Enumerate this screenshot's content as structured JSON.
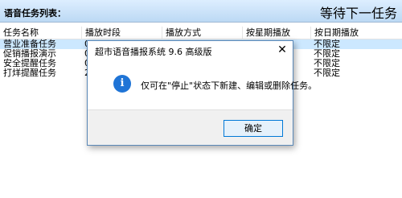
{
  "header": {
    "title": "语音任务列表：",
    "status": "等待下一任务"
  },
  "table": {
    "columns": [
      "任务名称",
      "播放时段",
      "播放方式",
      "按星期播放",
      "按日期播放"
    ],
    "rows": [
      [
        "营业准备任务",
        "0",
        "",
        "",
        "不限定"
      ],
      [
        "促销播报演示",
        "0",
        "",
        "",
        "不限定"
      ],
      [
        "安全提醒任务",
        "0",
        "",
        "",
        "不限定"
      ],
      [
        "打烊提醒任务",
        "2",
        "",
        "",
        "不限定"
      ]
    ]
  },
  "dialog": {
    "title": "超市语音播报系统 9.6 高级版",
    "close_glyph": "✕",
    "icon_glyph": "i",
    "message": "仅可在\"停止\"状态下新建、编辑或删除任务。",
    "ok_label": "确定"
  },
  "colors": {
    "selected_row": "#cce8ff",
    "info_icon": "#1f74d6",
    "button_border": "#0078d7"
  }
}
